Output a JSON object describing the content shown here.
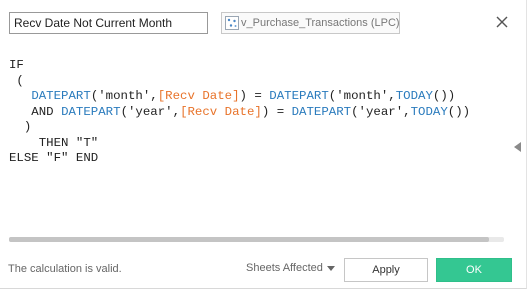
{
  "header": {
    "calc_name": "Recv Date Not Current Month",
    "datasource_label": "v_Purchase_Transactions (LPC)",
    "datasource_icon": "database-icon",
    "close_icon": "close-icon"
  },
  "editor": {
    "lines": [
      [
        {
          "t": "IF",
          "c": "kw"
        }
      ],
      [
        {
          "t": " (",
          "c": "kw"
        }
      ],
      [
        {
          "t": "   ",
          "c": "kw"
        },
        {
          "t": "DATEPART",
          "c": "fn"
        },
        {
          "t": "('month',",
          "c": "str"
        },
        {
          "t": "[Recv Date]",
          "c": "field"
        },
        {
          "t": ") = ",
          "c": "kw"
        },
        {
          "t": "DATEPART",
          "c": "fn"
        },
        {
          "t": "('month',",
          "c": "str"
        },
        {
          "t": "TODAY",
          "c": "fn"
        },
        {
          "t": "())",
          "c": "kw"
        }
      ],
      [
        {
          "t": "   AND ",
          "c": "kw"
        },
        {
          "t": "DATEPART",
          "c": "fn"
        },
        {
          "t": "('year',",
          "c": "str"
        },
        {
          "t": "[Recv Date]",
          "c": "field"
        },
        {
          "t": ") = ",
          "c": "kw"
        },
        {
          "t": "DATEPART",
          "c": "fn"
        },
        {
          "t": "('year',",
          "c": "str"
        },
        {
          "t": "TODAY",
          "c": "fn"
        },
        {
          "t": "())",
          "c": "kw"
        }
      ],
      [
        {
          "t": "  )",
          "c": "kw"
        }
      ],
      [
        {
          "t": "    THEN \"T\"",
          "c": "kw"
        }
      ],
      [
        {
          "t": "ELSE \"F\" END",
          "c": "kw"
        }
      ]
    ],
    "colors": {
      "function": "#2a7bbd",
      "field": "#e8732a",
      "text": "#222222"
    }
  },
  "footer": {
    "status": "The calculation is valid.",
    "sheets_affected": "Sheets Affected",
    "apply_label": "Apply",
    "ok_label": "OK",
    "ok_color": "#34c792"
  }
}
